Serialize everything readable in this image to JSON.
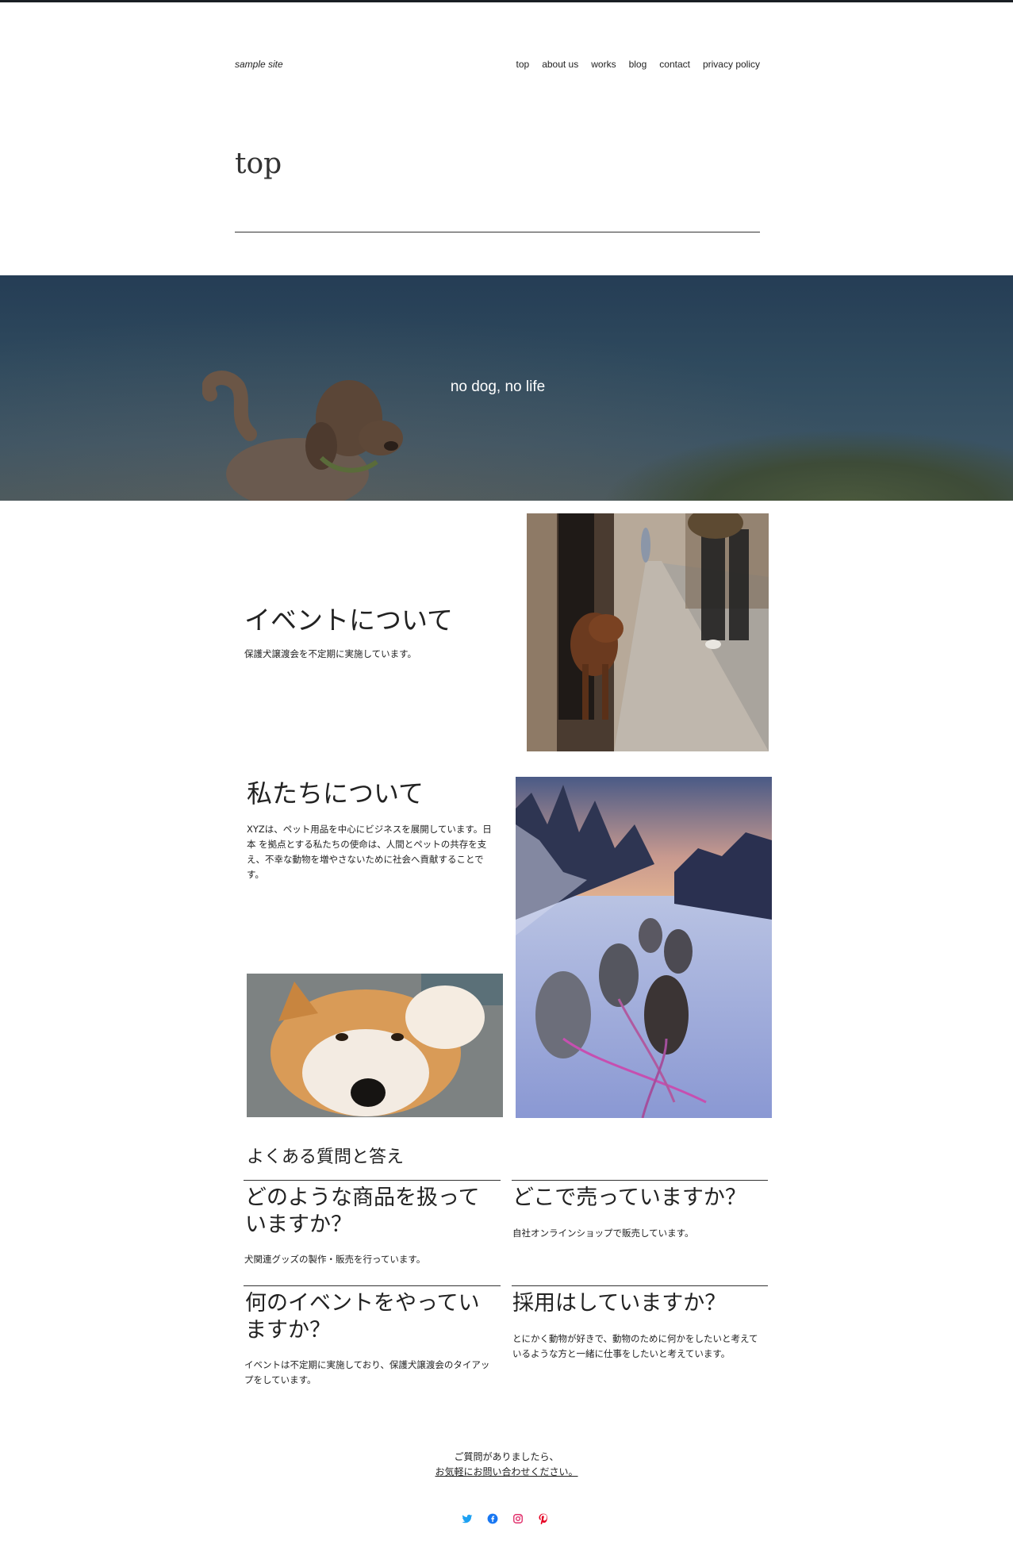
{
  "header": {
    "site_title": "sample site",
    "nav": [
      "top",
      "about us",
      "works",
      "blog",
      "contact",
      "privacy policy"
    ]
  },
  "page_title": "top",
  "hero": {
    "text": "no dog, no life"
  },
  "event": {
    "heading": "イベントについて",
    "text": "保護犬譲渡会を不定期に実施しています。"
  },
  "about": {
    "heading": "私たちについて",
    "lines": [
      "XYZは、ペット用品を中心にビジネスを展開しています。日",
      "本 を拠点とする私たちの使命は、人間とペットの共存を支",
      "え、不幸な動物を増やさないために社会へ貢献することで",
      "す。"
    ]
  },
  "faq": {
    "heading": "よくある質問と答え",
    "items": [
      {
        "q": [
          "どのような商品を扱って",
          "いますか？"
        ],
        "a": [
          "犬関連グッズの製作・販売を行っています。"
        ]
      },
      {
        "q": [
          "どこで売っていますか？"
        ],
        "a": [
          "自社オンラインショップで販売しています。"
        ]
      },
      {
        "q": [
          "何のイベントをやってい",
          "ますか？"
        ],
        "a": [
          "イベントは不定期に実施しており、保護犬譲渡会のタイアッ",
          "プをしています。"
        ]
      },
      {
        "q": [
          "採用はしていますか？"
        ],
        "a": [
          "とにかく動物が好きで、動物のために何かをしたいと考えて",
          "いるような方と一緒に仕事をしたいと考えています。"
        ]
      }
    ]
  },
  "footer": {
    "line1": "ご質問がありましたら、",
    "link": "お気軽にお問い合わせください。"
  },
  "social_icons": [
    "twitter-icon",
    "facebook-icon",
    "instagram-icon",
    "pinterest-icon"
  ],
  "colors": {
    "twitter": "#1da1f2",
    "facebook": "#1877f2",
    "instagram": "#e1306c",
    "pinterest": "#e60023"
  }
}
